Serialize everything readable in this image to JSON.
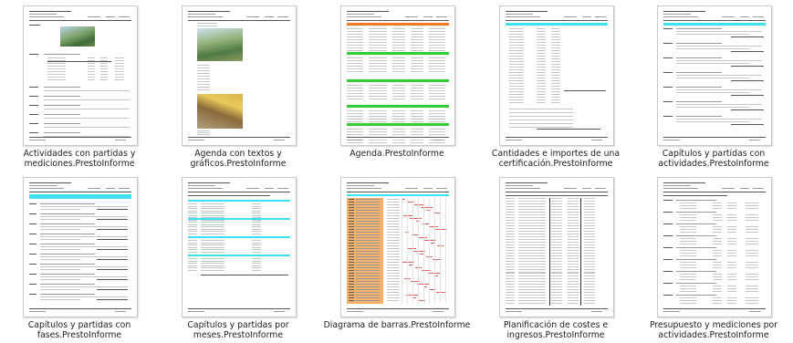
{
  "files": [
    {
      "line1": "Actividades con partidas y",
      "line2": "mediciones.PrestoInforme",
      "icon": "report-thumbnail-activities-icon"
    },
    {
      "line1": "Agenda con textos y",
      "line2": "gráficos.PrestoInforme",
      "icon": "report-thumbnail-agenda-graphics-icon"
    },
    {
      "line1": "Agenda.PrestoInforme",
      "line2": "",
      "icon": "report-thumbnail-agenda-icon"
    },
    {
      "line1": "Cantidades e importes de una",
      "line2": "certificación.PrestoInforme",
      "icon": "report-thumbnail-certification-icon"
    },
    {
      "line1": "Capítulos y partidas con",
      "line2": "actividades.PrestoInforme",
      "icon": "report-thumbnail-chapters-activities-icon"
    },
    {
      "line1": "Capítulos y partidas con",
      "line2": "fases.PrestoInforme",
      "icon": "report-thumbnail-chapters-phases-icon"
    },
    {
      "line1": "Capítulos y partidas por",
      "line2": "meses.PrestoInforme",
      "icon": "report-thumbnail-chapters-months-icon"
    },
    {
      "line1": "Diagrama de barras.PrestoInforme",
      "line2": "",
      "icon": "report-thumbnail-bar-chart-icon"
    },
    {
      "line1": "Planificación de costes e",
      "line2": "ingresos.PrestoInforme",
      "icon": "report-thumbnail-cost-planning-icon"
    },
    {
      "line1": "Presupuesto y mediciones por",
      "line2": "actividades.PrestoInforme",
      "icon": "report-thumbnail-budget-icon"
    }
  ],
  "colors": {
    "cyan_band": "#3fe0f0",
    "green_band": "#33cc33",
    "orange_band": "#f07a2a",
    "orange_fill": "#f5b06a",
    "caption_text": "#222222"
  }
}
